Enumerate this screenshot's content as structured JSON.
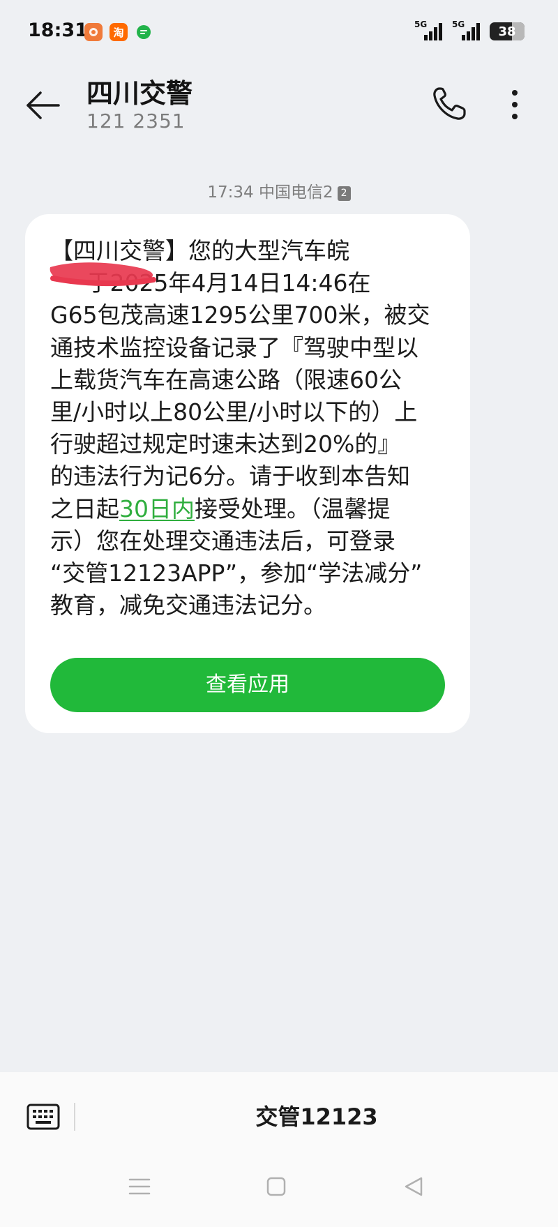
{
  "status_bar": {
    "time": "18:31",
    "apps": [
      {
        "icon": "app-icon-orange",
        "color": "#f07a3a",
        "glyph": ""
      },
      {
        "icon": "taobao-icon",
        "color": "#ff6a00",
        "glyph": "淘"
      },
      {
        "icon": "message-app-icon",
        "color": "#22b34a",
        "glyph": ""
      }
    ],
    "network_label": "5G",
    "battery_level": "38"
  },
  "header": {
    "contact_name": "四川交警",
    "contact_number": "121 2351"
  },
  "message": {
    "time": "17:34",
    "carrier": "中国电信2",
    "sim_badge": "2",
    "lines": [
      "【四川交警】您的大型汽车皖",
      "     于2025年4月14日14:46在",
      "G65包茂高速1295公里700米，被交",
      "通技术监控设备记录了『驾驶中型以",
      "上载货汽车在高速公路（限速60公",
      "里/小时以上80公里/小时以下的）上",
      "行驶超过规定时速未达到20%的』",
      "的违法行为记6分。请于收到本告知"
    ],
    "link_line_prefix": "之日起",
    "link_text": "30日内",
    "link_line_suffix": "接受处理。（温馨提",
    "lines_after": [
      "示）您在处理交通违法后，可登录",
      "“交管12123APP”，参加“学法减分”",
      "教育，减免交通违法记分。"
    ],
    "button_label": "查看应用",
    "accent_color": "#21b93a",
    "redaction_color": "#e8384f"
  },
  "bottom": {
    "quick_reply": "交管12123"
  }
}
